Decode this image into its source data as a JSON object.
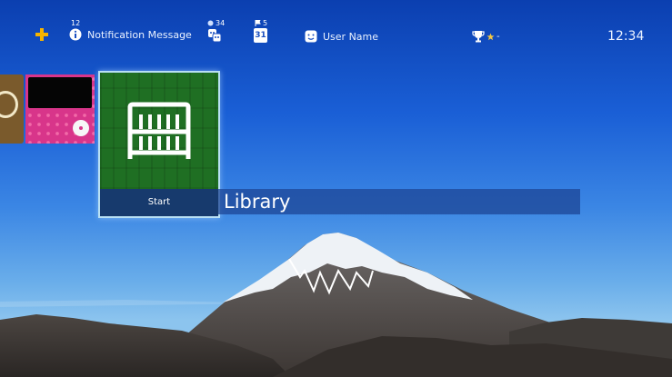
{
  "topbar": {
    "notification": {
      "count": "12",
      "label": "Notification Message",
      "icon": "info-icon"
    },
    "friends": {
      "count": "34",
      "icon": "friends-icon"
    },
    "events": {
      "count": "5",
      "icon": "calendar-icon",
      "day": "31"
    },
    "user": {
      "label": "User Name",
      "icon": "avatar-icon"
    },
    "trophy": {
      "label": "-",
      "icon": "trophy-icon"
    },
    "clock": "12:34"
  },
  "tiles": {
    "main_caption": "Start",
    "main_title": "Library"
  },
  "colors": {
    "sky_top": "#0b3fb0",
    "tile_green": "#1f6f23",
    "tile_pink": "#d8358a",
    "focus_border": "#b8e0f4",
    "title_bar": "#1e4696"
  }
}
